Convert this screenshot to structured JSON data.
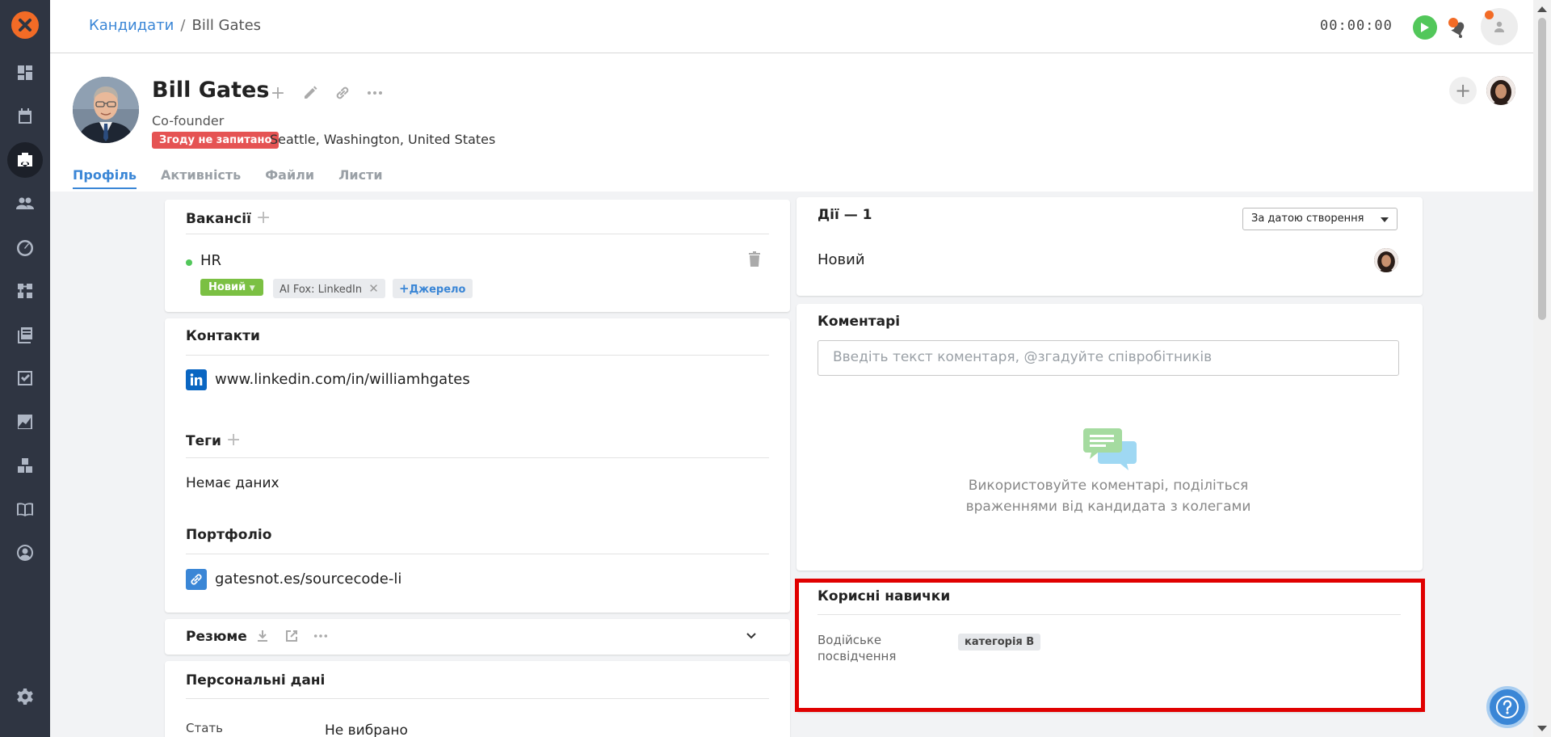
{
  "breadcrumb": {
    "parent": "Кандидати",
    "separator": "/",
    "current": "Bill Gates"
  },
  "timer": "00:00:00",
  "candidate": {
    "name": "Bill Gates",
    "position": "Co-founder",
    "consent_badge": "Згоду не запитано",
    "location": "Seattle, Washington, United States"
  },
  "tabs": [
    {
      "label": "Профіль",
      "active": true
    },
    {
      "label": "Активність",
      "active": false
    },
    {
      "label": "Файли",
      "active": false
    },
    {
      "label": "Листи",
      "active": false
    }
  ],
  "vacancies": {
    "title": "Вакансії",
    "item": {
      "name": "HR",
      "status": "Новий",
      "source": "AI Fox: LinkedIn",
      "add_source": "Джерело"
    }
  },
  "contacts": {
    "title": "Контакти",
    "linkedin": "www.linkedin.com/in/williamhgates"
  },
  "tags": {
    "title": "Теги",
    "empty": "Немає даних"
  },
  "portfolio": {
    "title": "Портфоліо",
    "link": "gatesnot.es/sourcecode-li"
  },
  "resume": {
    "title": "Резюме"
  },
  "personal": {
    "title": "Персональні дані",
    "gender_label": "Стать",
    "gender_value": "Не вибрано"
  },
  "actions": {
    "title": "Дії — 1",
    "sort": "За датою створення",
    "item": "Новий"
  },
  "comments": {
    "title": "Коментарі",
    "placeholder": "Введіть текст коментаря, @згадуйте співробітників",
    "empty_line1": "Використовуйте коментарі, поділіться",
    "empty_line2": "враженнями від кандидата з колегами"
  },
  "skills": {
    "title": "Корисні навички",
    "label_line1": "Водійське",
    "label_line2": "посвідчення",
    "value": "категорія B"
  },
  "colors": {
    "accent": "#3a86d6",
    "brand": "#f26b26",
    "sidebar": "#2f3542",
    "success": "#52c75a",
    "danger": "#e55353",
    "highlight": "#e00000"
  }
}
